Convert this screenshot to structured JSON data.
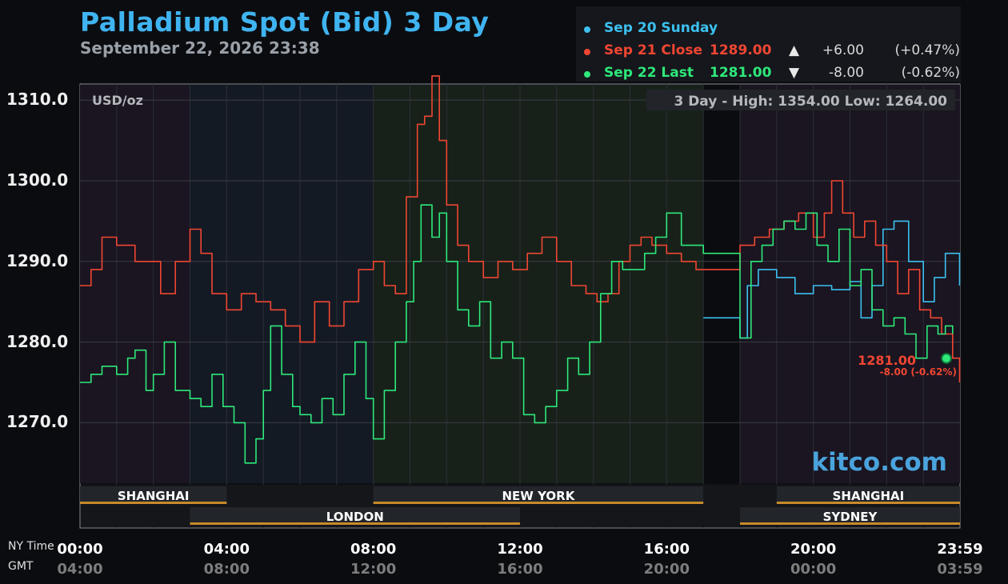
{
  "header": {
    "title": "Palladium Spot (Bid) 3 Day",
    "subtitle": "September 22, 2026 23:38"
  },
  "legend": [
    {
      "label": "Sep 20 Sunday",
      "value": "",
      "arrow": "",
      "change": "",
      "pct": "",
      "color": "#3cc0f0"
    },
    {
      "label": "Sep 21 Close",
      "value": "1289.00",
      "arrow": "▲",
      "change": "+6.00",
      "pct": "(+0.47%)",
      "color": "#f04632"
    },
    {
      "label": "Sep 22 Last",
      "value": "1281.00",
      "arrow": "▼",
      "change": "-8.00",
      "pct": "(-0.62%)",
      "color": "#2ee87a"
    }
  ],
  "plot": {
    "unit_label": "USD/oz",
    "range_label": "3 Day - High: 1354.00  Low: 1264.00",
    "watermark": "kitco.com",
    "last_price": "1281.00",
    "last_change": "-8.00 (-0.62%)"
  },
  "sessions": [
    {
      "name": "SHANGHAI",
      "start": 0,
      "end": 4,
      "row": 1
    },
    {
      "name": "NEW YORK",
      "start": 8,
      "end": 17,
      "row": 1
    },
    {
      "name": "SHANGHAI",
      "start": 19,
      "end": 24,
      "row": 1
    },
    {
      "name": "LONDON",
      "start": 3,
      "end": 12,
      "row": 2
    },
    {
      "name": "SYDNEY",
      "start": 18,
      "end": 24,
      "row": 2
    }
  ],
  "x_axis": {
    "ny_label": "NY Time",
    "gmt_label": "GMT",
    "ny_ticks": [
      "00:00",
      "04:00",
      "08:00",
      "12:00",
      "16:00",
      "20:00",
      "23:59"
    ],
    "gmt_ticks": [
      "04:00",
      "08:00",
      "12:00",
      "16:00",
      "20:00",
      "00:00",
      "03:59"
    ]
  },
  "chart_data": {
    "type": "line",
    "title": "Palladium Spot (Bid) 3 Day",
    "ylabel": "USD/oz",
    "ylim": [
      1262.5,
      1312.0
    ],
    "xlim": [
      0,
      24
    ],
    "x_unit": "hours (NY Time)",
    "y_ticks": [
      "1270.0",
      "1280.0",
      "1290.0",
      "1300.0",
      "1310.0"
    ],
    "grid": true,
    "series": [
      {
        "name": "Sep 20 Sunday",
        "color": "#3cc0f0",
        "x": [
          17.0,
          18.0,
          18.0,
          18.2,
          18.5,
          19.0,
          19.5,
          20.0,
          20.5,
          21.0,
          21.3,
          21.6,
          21.9,
          22.2,
          22.6,
          23.0,
          23.3,
          23.6,
          23.99
        ],
        "y": [
          1283.0,
          1283.0,
          1280.5,
          1287.0,
          1289.0,
          1288.0,
          1286.0,
          1287.0,
          1286.5,
          1287.5,
          1283.0,
          1287.0,
          1294.0,
          1295.0,
          1290.0,
          1285.0,
          1288.0,
          1291.0,
          1287.0
        ]
      },
      {
        "name": "Sep 21 Close",
        "color": "#f04632",
        "x": [
          0.0,
          0.3,
          0.6,
          1.0,
          1.5,
          1.8,
          2.2,
          2.6,
          3.0,
          3.3,
          3.6,
          4.0,
          4.4,
          4.8,
          5.2,
          5.6,
          6.0,
          6.4,
          6.8,
          7.2,
          7.6,
          8.0,
          8.3,
          8.6,
          8.9,
          9.2,
          9.4,
          9.6,
          9.8,
          10.0,
          10.3,
          10.6,
          11.0,
          11.4,
          11.8,
          12.2,
          12.6,
          13.0,
          13.4,
          13.8,
          14.1,
          14.4,
          14.7,
          15.0,
          15.3,
          15.6,
          16.0,
          16.4,
          16.8,
          17.0,
          18.0,
          18.0,
          18.4,
          18.8,
          19.2,
          19.6,
          20.0,
          20.3,
          20.5,
          20.8,
          21.1,
          21.4,
          21.7,
          22.0,
          22.3,
          22.6,
          22.9,
          23.2,
          23.5,
          23.8,
          23.99
        ],
        "y": [
          1287.0,
          1289.0,
          1293.0,
          1292.0,
          1290.0,
          1290.0,
          1286.0,
          1290.0,
          1294.0,
          1291.0,
          1286.0,
          1284.0,
          1286.0,
          1285.0,
          1284.0,
          1282.0,
          1280.0,
          1285.0,
          1282.0,
          1285.0,
          1289.0,
          1290.0,
          1287.0,
          1286.0,
          1298.0,
          1307.0,
          1308.0,
          1313.0,
          1305.0,
          1297.0,
          1292.0,
          1290.0,
          1288.0,
          1290.0,
          1289.0,
          1291.0,
          1293.0,
          1290.0,
          1287.0,
          1286.0,
          1285.0,
          1286.0,
          1290.0,
          1292.0,
          1293.0,
          1292.0,
          1291.0,
          1290.0,
          1289.0,
          1289.0,
          1289.0,
          1292.0,
          1293.0,
          1294.0,
          1295.0,
          1296.0,
          1293.0,
          1296.0,
          1300.0,
          1296.0,
          1293.0,
          1295.0,
          1292.0,
          1290.0,
          1286.0,
          1289.0,
          1284.0,
          1283.0,
          1281.0,
          1278.0,
          1275.0
        ]
      },
      {
        "name": "Sep 22 Last",
        "color": "#2ee87a",
        "x": [
          0.0,
          0.3,
          0.6,
          1.0,
          1.3,
          1.5,
          1.8,
          2.0,
          2.3,
          2.6,
          3.0,
          3.3,
          3.6,
          3.9,
          4.2,
          4.5,
          4.8,
          5.0,
          5.2,
          5.5,
          5.8,
          6.0,
          6.3,
          6.6,
          6.9,
          7.2,
          7.5,
          7.8,
          8.0,
          8.3,
          8.6,
          8.9,
          9.1,
          9.3,
          9.6,
          9.8,
          10.0,
          10.3,
          10.6,
          10.9,
          11.2,
          11.5,
          11.8,
          12.1,
          12.4,
          12.7,
          13.0,
          13.3,
          13.6,
          13.9,
          14.2,
          14.5,
          14.8,
          15.1,
          15.4,
          15.7,
          16.0,
          16.4,
          16.8,
          17.0,
          18.0,
          18.0,
          18.3,
          18.6,
          18.9,
          19.2,
          19.5,
          19.8,
          20.1,
          20.4,
          20.7,
          21.0,
          21.3,
          21.6,
          21.9,
          22.2,
          22.5,
          22.8,
          23.1,
          23.4,
          23.6,
          23.8
        ],
        "y": [
          1275.0,
          1276.0,
          1277.0,
          1276.0,
          1278.0,
          1279.0,
          1274.0,
          1276.0,
          1280.0,
          1274.0,
          1273.0,
          1272.0,
          1276.0,
          1272.0,
          1270.0,
          1265.0,
          1268.0,
          1274.0,
          1282.0,
          1276.0,
          1272.0,
          1271.0,
          1270.0,
          1273.0,
          1271.0,
          1276.0,
          1280.0,
          1273.0,
          1268.0,
          1274.0,
          1280.0,
          1285.0,
          1290.0,
          1297.0,
          1293.0,
          1296.0,
          1290.0,
          1284.0,
          1282.0,
          1285.0,
          1278.0,
          1280.0,
          1278.0,
          1271.0,
          1270.0,
          1272.0,
          1274.0,
          1278.0,
          1276.0,
          1280.0,
          1286.0,
          1290.0,
          1289.0,
          1289.0,
          1291.0,
          1293.0,
          1296.0,
          1292.0,
          1292.0,
          1291.0,
          1291.0,
          1280.5,
          1290.0,
          1292.0,
          1294.0,
          1295.0,
          1294.0,
          1296.0,
          1292.0,
          1290.0,
          1294.0,
          1287.0,
          1289.0,
          1284.0,
          1282.0,
          1283.0,
          1281.0,
          1278.0,
          1282.0,
          1281.0,
          1282.0,
          1281.0
        ]
      }
    ]
  }
}
